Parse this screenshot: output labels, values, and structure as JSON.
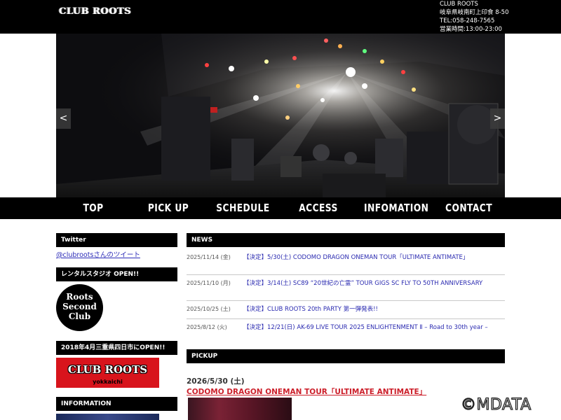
{
  "header": {
    "logo_text": "CLUB ROOTS",
    "info": [
      "CLUB ROOTS",
      "岐阜県岐南町上印食 8-50",
      "TEL:058-248-7565",
      "営業時間:13:00-23:00"
    ]
  },
  "hero": {
    "prev_label": "<",
    "next_label": ">"
  },
  "nav": {
    "items": [
      "TOP",
      "PICK UP",
      "SCHEDULE",
      "ACCESS",
      "INFOMATION",
      "CONTACT"
    ]
  },
  "sidebar": {
    "twitter_head": "Twitter",
    "tweet_link": "@clubrootsさんのツイート",
    "rental_head": "レンタルスタジオ OPEN!!",
    "roots_second_logo": [
      "Roots",
      "Second",
      "Club"
    ],
    "yokkaichi_head": "2018年4月三重県四日市にOPEN!!",
    "yokkaichi_logo": "CLUB ROOTS",
    "yokkaichi_sub": "yokkaichi",
    "information_head": "INFORMATION"
  },
  "news": {
    "head": "NEWS",
    "items": [
      {
        "date": "2025/11/14 (金)",
        "title": "【決定】5/30(土) CODOMO DRAGON ONEMAN TOUR「ULTIMATE ANTIMATE」"
      },
      {
        "date": "2025/11/10 (月)",
        "title": "【決定】3/14(土) SC89 “20世紀の亡霊” TOUR GIGS SC FLY TO 50TH ANNIVERSARY"
      },
      {
        "date": "2025/10/25 (土)",
        "title": "【決定】CLUB ROOTS 20th PARTY 第一弾発表!!"
      },
      {
        "date": "2025/8/12 (火)",
        "title": "【決定】12/21(日) AK-69 LIVE TOUR 2025 ENLIGHTENMENT Ⅱ – Road to 30th year –"
      }
    ]
  },
  "pickup": {
    "head": "PICKUP",
    "date": "2026/5/30 (土)",
    "title": "CODOMO DRAGON ONEMAN TOUR「ULTIMATE ANTIMATE」"
  },
  "watermark": "©MDATA"
}
